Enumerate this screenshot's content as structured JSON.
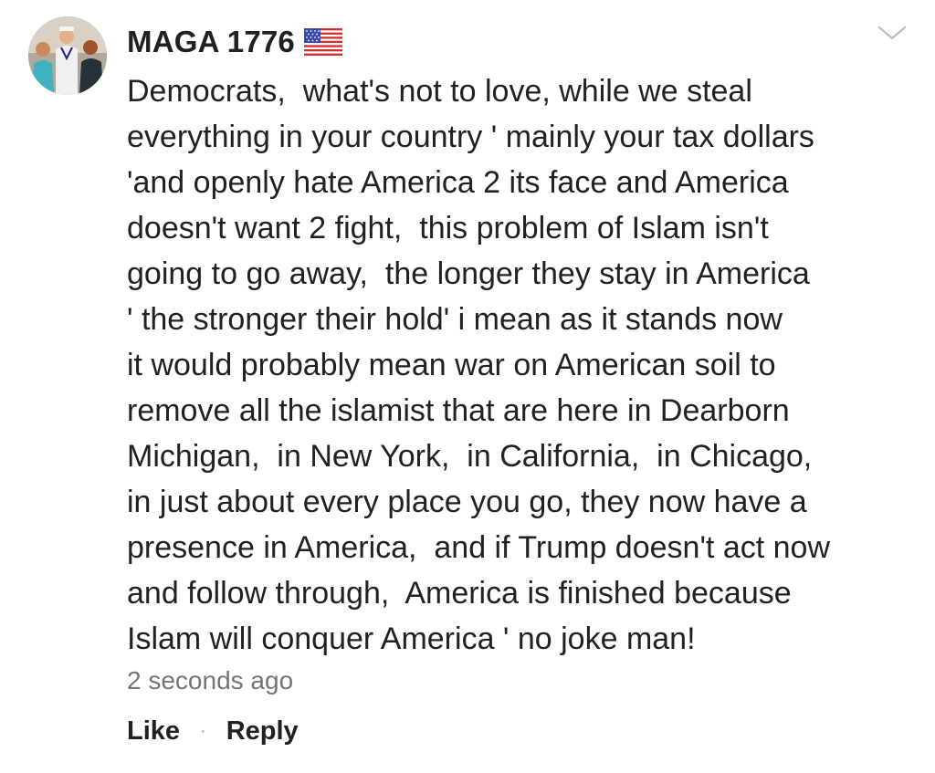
{
  "comment": {
    "author": "MAGA 1776",
    "author_flag_icon": "us-flag-icon",
    "menu_icon": "chevron-down-icon",
    "lines": [
      "Democrats,  what's not to love, while we steal",
      "everything in your country ' mainly your tax dollars",
      "'and openly hate America 2 its face and America",
      "doesn't want 2 fight,  this problem of Islam isn't",
      "going to go away,  the longer they stay in America",
      "' the stronger their hold' i mean as it stands now",
      "it would probably mean war on American soil to",
      "remove all the islamist that are here in Dearborn",
      "Michigan,  in New York,  in California,  in Chicago,",
      "in just about every place you go, they now have a",
      "presence in America,  and if Trump doesn't act now",
      "and follow through,  America is finished because",
      "Islam will conquer America ' no joke man!"
    ],
    "timestamp": "2 seconds ago",
    "like_label": "Like",
    "separator": "·",
    "reply_label": "Reply"
  },
  "colors": {
    "text": "#212121",
    "muted": "#757575",
    "chevron": "#bdbdbd"
  }
}
